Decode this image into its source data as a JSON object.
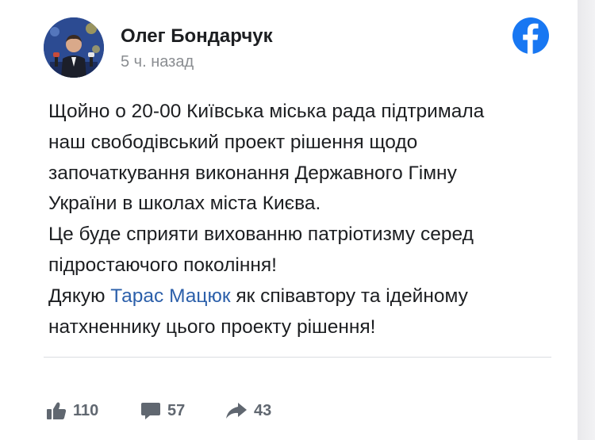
{
  "post": {
    "author": "Олег Бондарчук",
    "timestamp": "5 ч. назад",
    "text": {
      "line1": "Щойно о 20-00 Київська міська рада підтримала",
      "line2": "наш свободівський проект рішення щодо",
      "line3": "започаткування виконання Державного Гімну",
      "line4": "України в школах міста Києва.",
      "line5": "Це буде сприяти вихованню патріотизму серед",
      "line6": "підростаючого покоління!",
      "line7_before": "Дякую ",
      "line7_mention": "Тарас Мацюк",
      "line7_after": " як співавтору та ідейному",
      "line8": "натхненнику цього проекту рішення!"
    }
  },
  "stats": {
    "likes": "110",
    "comments": "57",
    "shares": "43"
  },
  "icons": {
    "platform": "facebook-icon",
    "like": "thumbs-up-icon",
    "comment": "comment-bubble-icon",
    "share": "share-arrow-icon"
  },
  "colors": {
    "facebook_blue": "#1877f2",
    "mention_blue": "#2b5faa",
    "text": "#1c1e21",
    "muted": "#8a8d91",
    "stat_gray": "#606770"
  }
}
